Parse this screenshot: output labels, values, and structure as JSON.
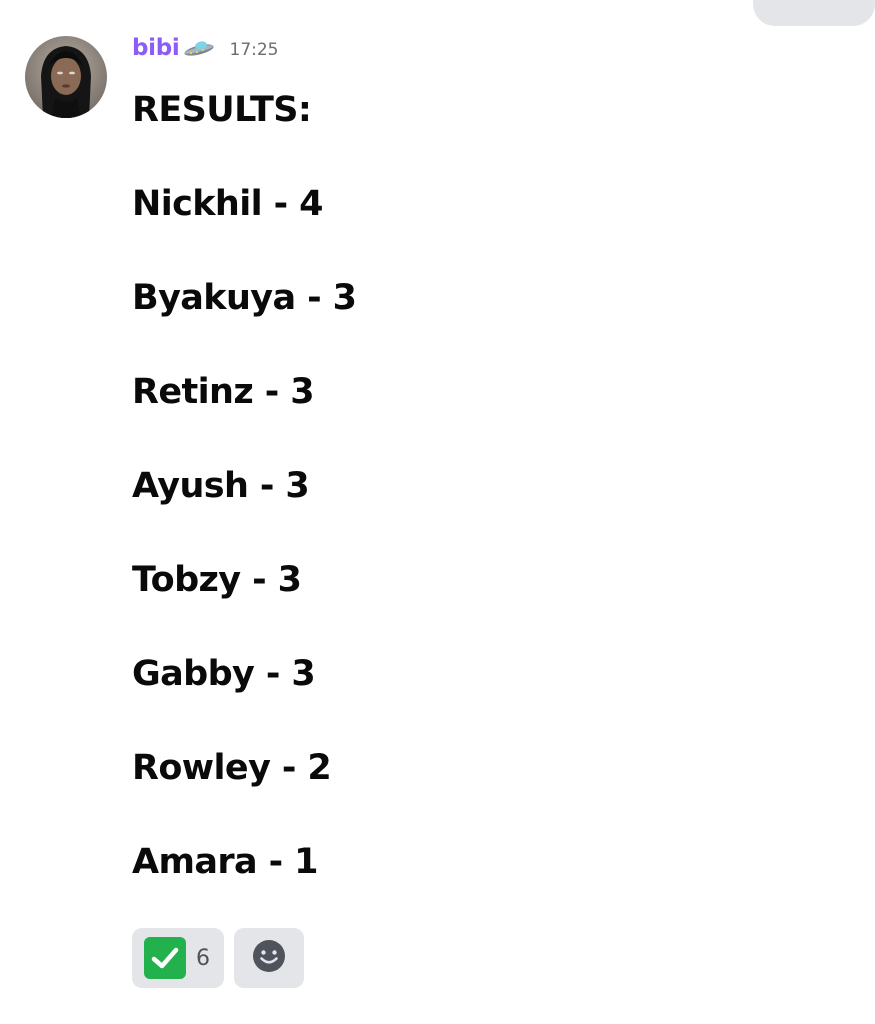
{
  "message": {
    "author": "bibi",
    "author_emoji": "ufo-icon",
    "timestamp": "17:25",
    "lines": [
      "RESULTS:",
      "Nickhil - 4",
      "Byakuya - 3",
      "Retinz - 3",
      "Ayush - 3",
      "Tobzy - 3",
      "Gabby - 3",
      "Rowley - 2",
      "Amara - 1"
    ]
  },
  "reactions": [
    {
      "icon": "white-check-mark-icon",
      "count": "6"
    },
    {
      "icon": "add-reaction-smiley-icon"
    }
  ],
  "colors": {
    "username": "#8b5cf6",
    "text": "#0a0a0a",
    "timestamp": "#6b6d73",
    "reaction_bg": "#e4e5e8",
    "check_green": "#22b14c"
  }
}
